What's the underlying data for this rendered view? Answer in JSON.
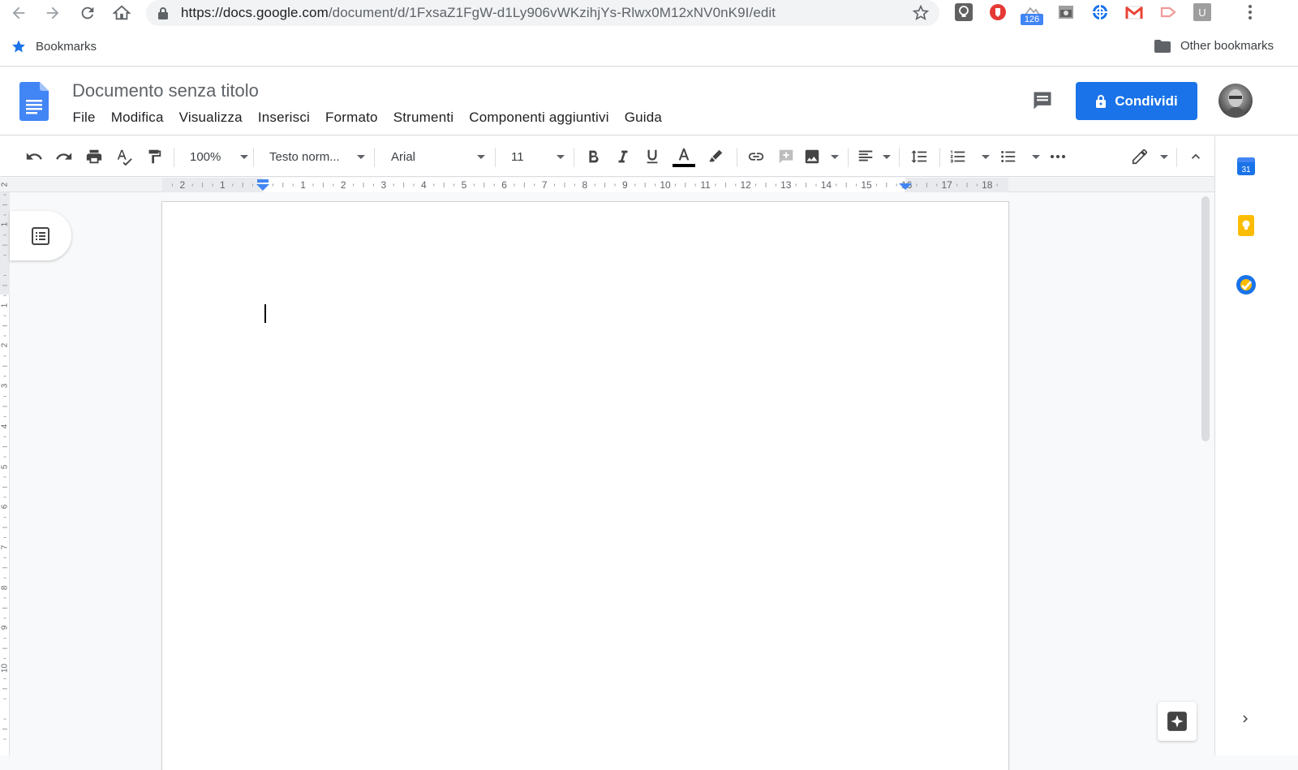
{
  "browser": {
    "url_host": "https://docs.google.com",
    "url_path": "/document/d/1FxsaZ1FgW-d1Ly906vWKzihjYs-Rlwx0M12xNV0nK9I/edit",
    "extension_badge": "126",
    "bookmarks_label": "Bookmarks",
    "other_bookmarks_label": "Other bookmarks"
  },
  "docs": {
    "title": "Documento senza titolo",
    "menu": [
      "File",
      "Modifica",
      "Visualizza",
      "Inserisci",
      "Formato",
      "Strumenti",
      "Componenti aggiuntivi",
      "Guida"
    ],
    "share_label": "Condividi"
  },
  "toolbar": {
    "zoom": "100%",
    "style": "Testo norm...",
    "font": "Arial",
    "size": "11"
  },
  "ruler": {
    "numbers": [
      "2",
      "1",
      "1",
      "2",
      "3",
      "4",
      "5",
      "6",
      "7",
      "8",
      "9",
      "10",
      "11",
      "12",
      "13",
      "14",
      "15",
      "16",
      "17",
      "18"
    ]
  },
  "vertical_ruler": {
    "numbers": [
      "2",
      "1",
      "1",
      "2",
      "3",
      "4",
      "5",
      "6",
      "7",
      "8",
      "9",
      "10"
    ]
  },
  "side_panel": {
    "calendar_day": "31"
  },
  "colors": {
    "accent": "#1a73e8",
    "docs_blue": "#4285f4",
    "keep_yellow": "#fbbc04",
    "gmail_red": "#ea4335"
  }
}
